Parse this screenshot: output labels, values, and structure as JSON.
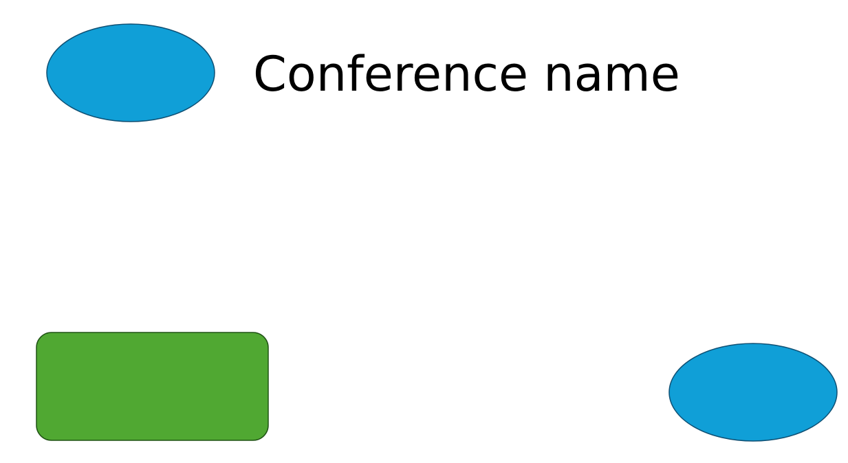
{
  "title": "Conference name",
  "shapes": [
    {
      "name": "top-left-ellipse",
      "kind": "ellipse",
      "fill": "#109FD7",
      "stroke": "#0E4F73"
    },
    {
      "name": "bottom-left-rounded-rectangle",
      "kind": "rounded-rectangle",
      "fill": "#50A832",
      "stroke": "#1F5214"
    },
    {
      "name": "bottom-right-ellipse",
      "kind": "ellipse",
      "fill": "#109FD7",
      "stroke": "#0E4F73"
    }
  ]
}
